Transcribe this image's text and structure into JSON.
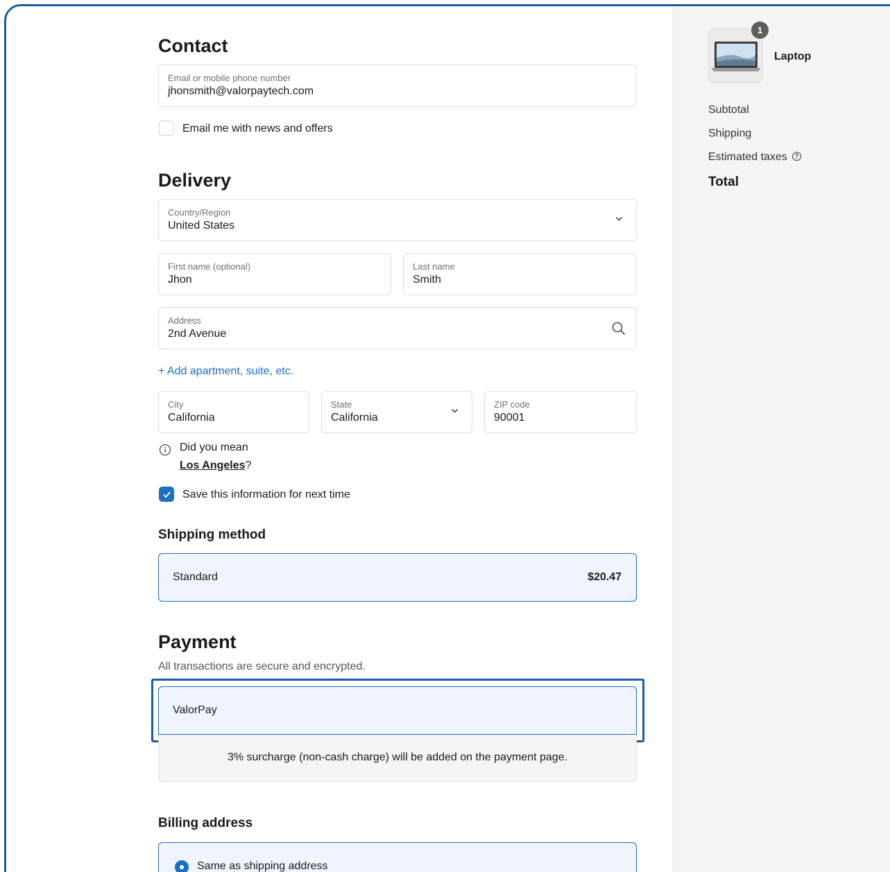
{
  "contact": {
    "heading": "Contact",
    "email_label": "Email or mobile phone number",
    "email_value": "jhonsmith@valorpaytech.com",
    "news_checkbox_label": "Email me with news and offers",
    "news_checked": false
  },
  "delivery": {
    "heading": "Delivery",
    "country_label": "Country/Region",
    "country_value": "United States",
    "first_name_label": "First name (optional)",
    "first_name_value": "Jhon",
    "last_name_label": "Last name",
    "last_name_value": "Smith",
    "address_label": "Address",
    "address_value": "2nd Avenue",
    "add_apartment_link": "+ Add apartment, suite, etc.",
    "city_label": "City",
    "city_value": "California",
    "state_label": "State",
    "state_value": "California",
    "zip_label": "ZIP code",
    "zip_value": "90001",
    "suggestion_prefix": "Did you mean",
    "suggestion_city": "Los Angeles",
    "suggestion_suffix": "?",
    "save_info_label": "Save this information for next time",
    "save_info_checked": true
  },
  "shipping_method": {
    "heading": "Shipping method",
    "option_name": "Standard",
    "option_price": "$20.47"
  },
  "payment": {
    "heading": "Payment",
    "subtext": "All transactions are secure and encrypted.",
    "method_name": "ValorPay",
    "surcharge_note": "3% surcharge (non-cash charge) will be added on the payment page."
  },
  "billing": {
    "heading": "Billing address",
    "same_as_shipping_label": "Same as shipping address"
  },
  "order_summary": {
    "product_name": "Laptop",
    "quantity": "1",
    "subtotal_label": "Subtotal",
    "shipping_label": "Shipping",
    "taxes_label": "Estimated taxes",
    "total_label": "Total"
  },
  "colors": {
    "accent": "#1d6fc2",
    "frame_border": "#1d5aa8",
    "selected_bg": "#f0f5fd"
  }
}
